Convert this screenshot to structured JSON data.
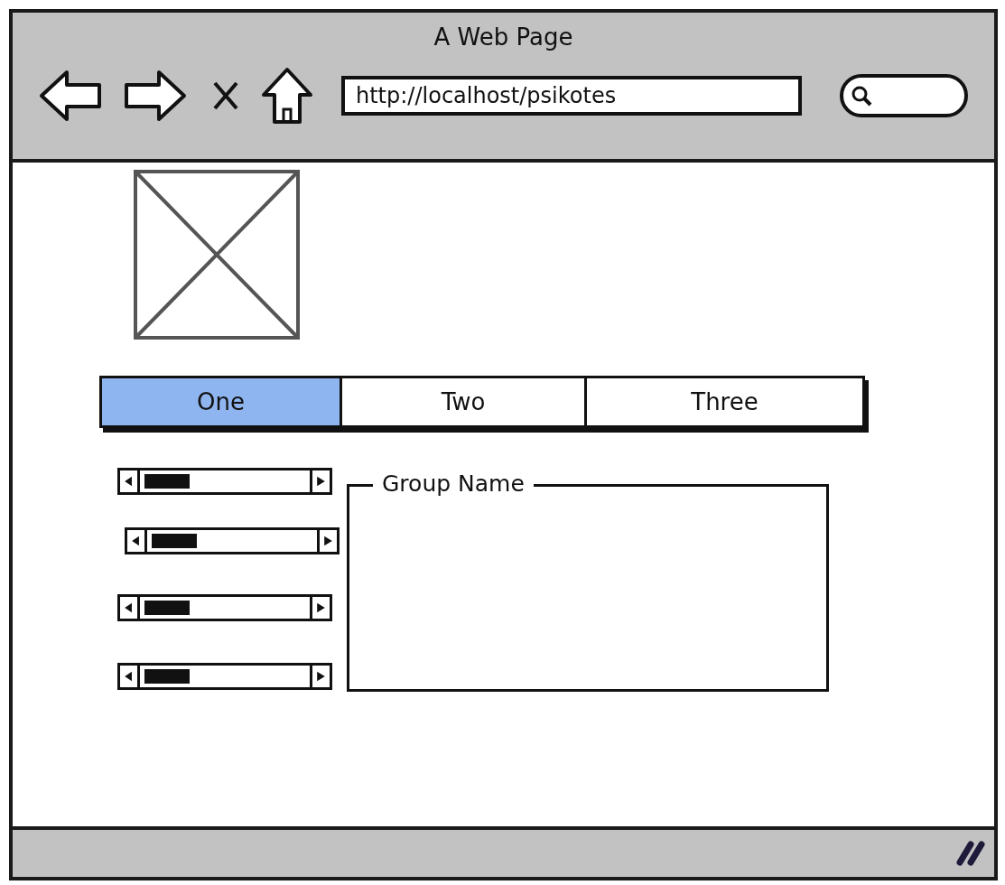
{
  "window": {
    "title": "A Web Page"
  },
  "address_bar": {
    "value": "http://localhost/psikotes"
  },
  "tabs": [
    {
      "label": "One",
      "selected": true
    },
    {
      "label": "Two",
      "selected": false
    },
    {
      "label": "Three",
      "selected": false
    }
  ],
  "group": {
    "title": "Group Name"
  }
}
